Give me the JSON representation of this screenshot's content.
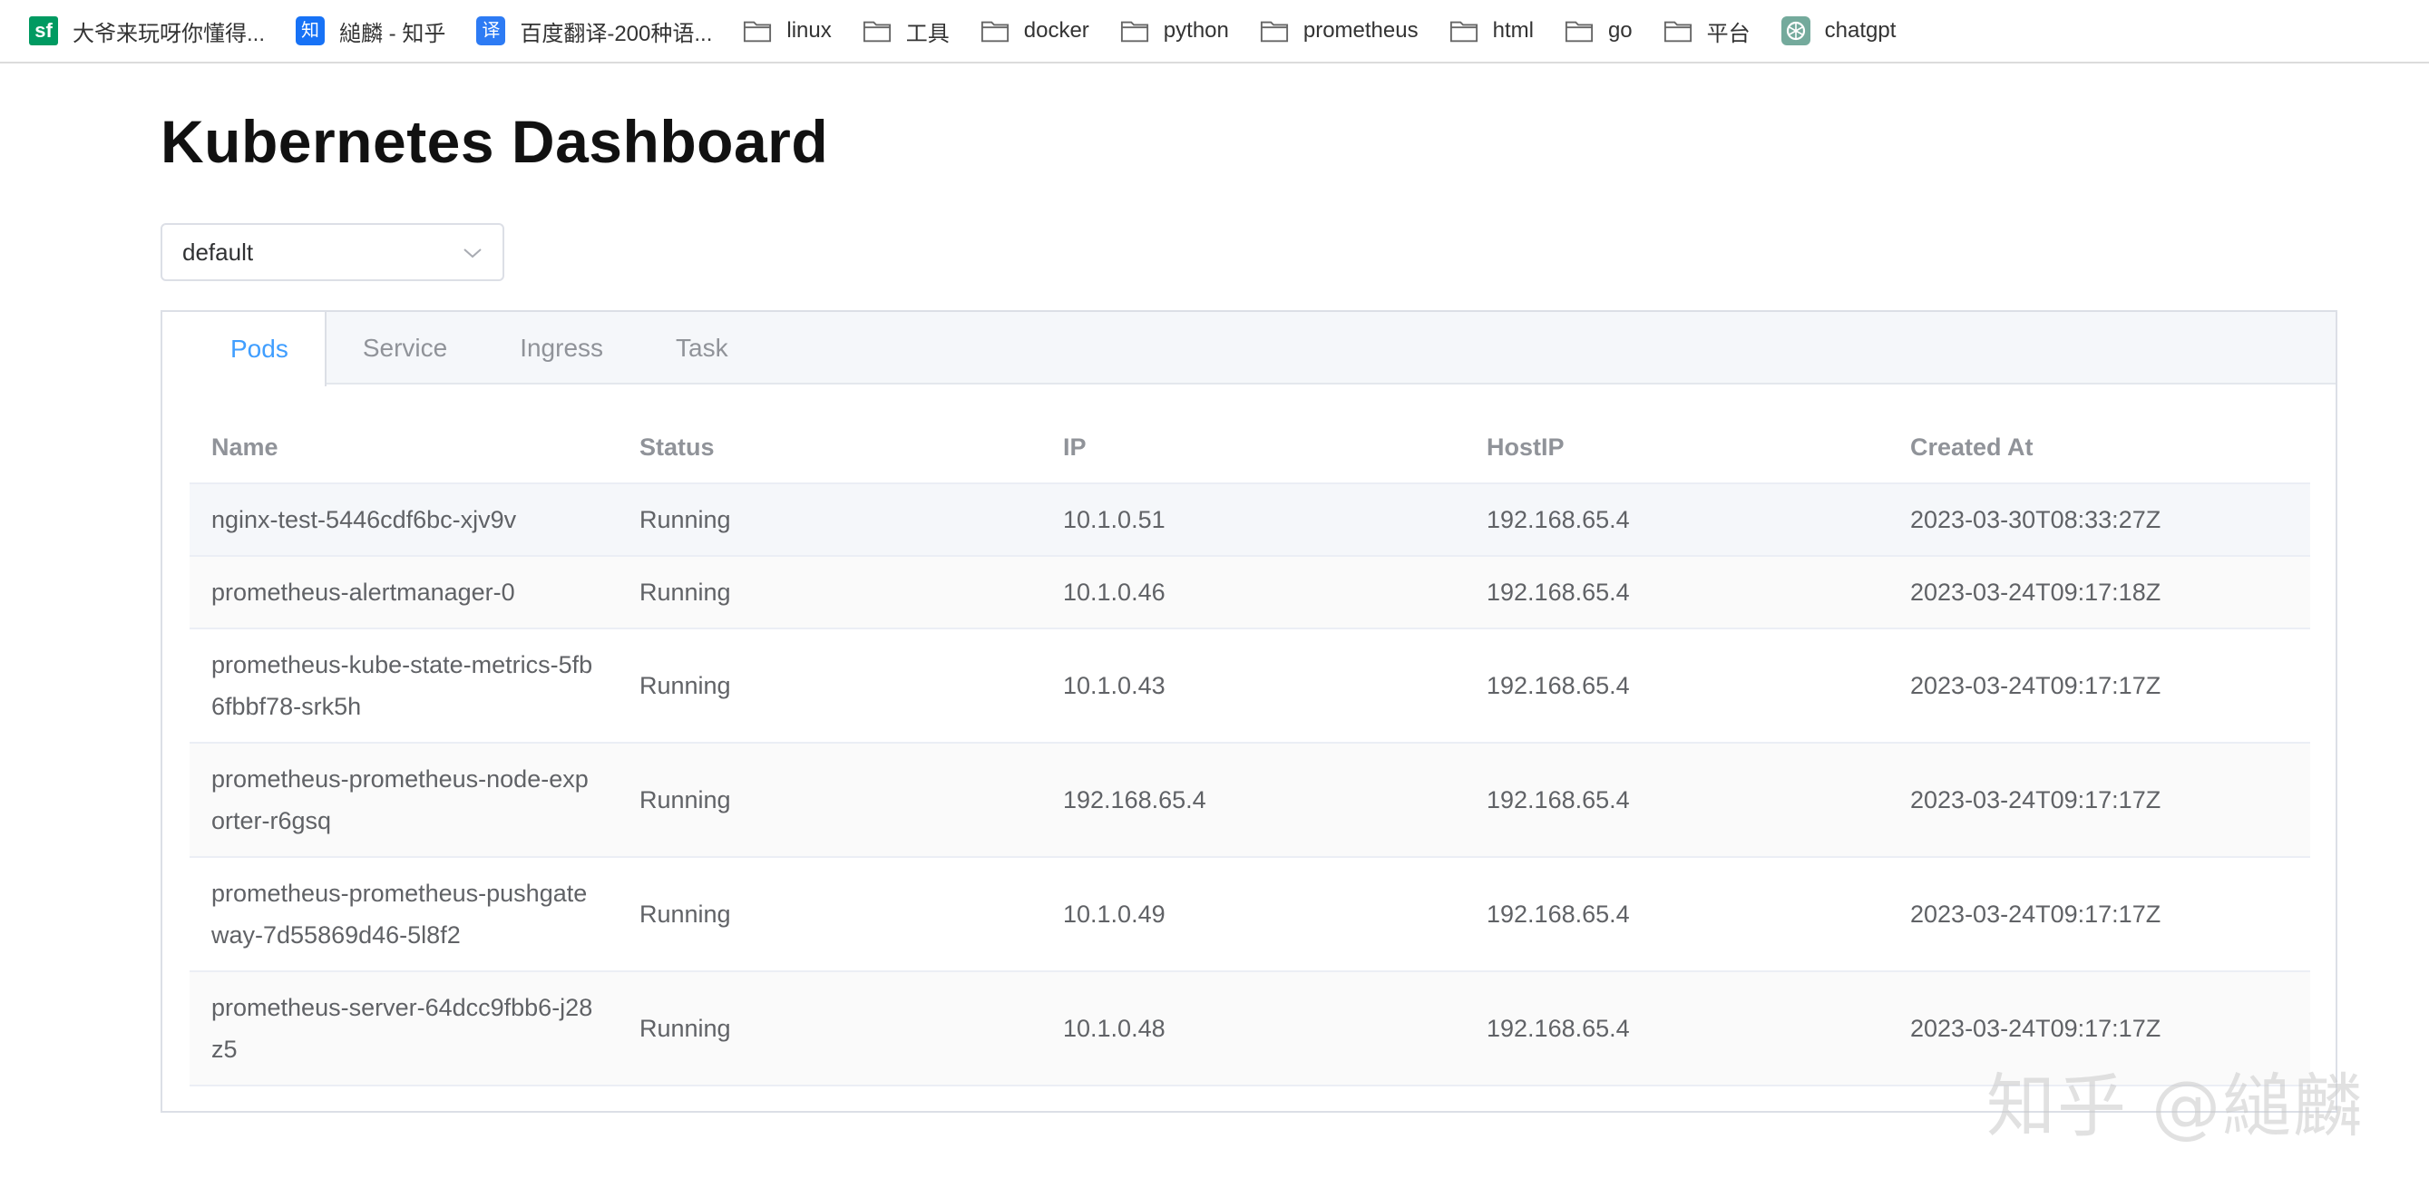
{
  "bookmarks": [
    {
      "label": "大爷来玩呀你懂得...",
      "icon": "segmentfault-icon",
      "glyph": "sf"
    },
    {
      "label": "縋麟 - 知乎",
      "icon": "zhihu-icon",
      "glyph": "知"
    },
    {
      "label": "百度翻译-200种语...",
      "icon": "baidu-translate-icon",
      "glyph": "译"
    },
    {
      "label": "linux",
      "icon": "folder-icon"
    },
    {
      "label": "工具",
      "icon": "folder-icon"
    },
    {
      "label": "docker",
      "icon": "folder-icon"
    },
    {
      "label": "python",
      "icon": "folder-icon"
    },
    {
      "label": "prometheus",
      "icon": "folder-icon"
    },
    {
      "label": "html",
      "icon": "folder-icon"
    },
    {
      "label": "go",
      "icon": "folder-icon"
    },
    {
      "label": "平台",
      "icon": "folder-icon"
    },
    {
      "label": "chatgpt",
      "icon": "chatgpt-icon"
    }
  ],
  "page": {
    "title": "Kubernetes Dashboard"
  },
  "namespace_select": {
    "value": "default"
  },
  "tabs": [
    {
      "label": "Pods",
      "active": true
    },
    {
      "label": "Service",
      "active": false
    },
    {
      "label": "Ingress",
      "active": false
    },
    {
      "label": "Task",
      "active": false
    }
  ],
  "table": {
    "columns": [
      "Name",
      "Status",
      "IP",
      "HostIP",
      "Created At"
    ],
    "rows": [
      {
        "name": "nginx-test-5446cdf6bc-xjv9v",
        "status": "Running",
        "ip": "10.1.0.51",
        "host_ip": "192.168.65.4",
        "created_at": "2023-03-30T08:33:27Z"
      },
      {
        "name": "prometheus-alertmanager-0",
        "status": "Running",
        "ip": "10.1.0.46",
        "host_ip": "192.168.65.4",
        "created_at": "2023-03-24T09:17:18Z"
      },
      {
        "name": "prometheus-kube-state-metrics-5fb6fbbf78-srk5h",
        "status": "Running",
        "ip": "10.1.0.43",
        "host_ip": "192.168.65.4",
        "created_at": "2023-03-24T09:17:17Z"
      },
      {
        "name": "prometheus-prometheus-node-exporter-r6gsq",
        "status": "Running",
        "ip": "192.168.65.4",
        "host_ip": "192.168.65.4",
        "created_at": "2023-03-24T09:17:17Z"
      },
      {
        "name": "prometheus-prometheus-pushgateway-7d55869d46-5l8f2",
        "status": "Running",
        "ip": "10.1.0.49",
        "host_ip": "192.168.65.4",
        "created_at": "2023-03-24T09:17:17Z"
      },
      {
        "name": "prometheus-server-64dcc9fbb6-j28z5",
        "status": "Running",
        "ip": "10.1.0.48",
        "host_ip": "192.168.65.4",
        "created_at": "2023-03-24T09:17:17Z"
      }
    ]
  },
  "watermark": {
    "text": "知乎 @縋麟"
  },
  "colors": {
    "accent": "#409eff",
    "header_text": "#909399",
    "body_text": "#606266",
    "border": "#ebeef5",
    "tab_bar_bg": "#f5f7fa"
  }
}
